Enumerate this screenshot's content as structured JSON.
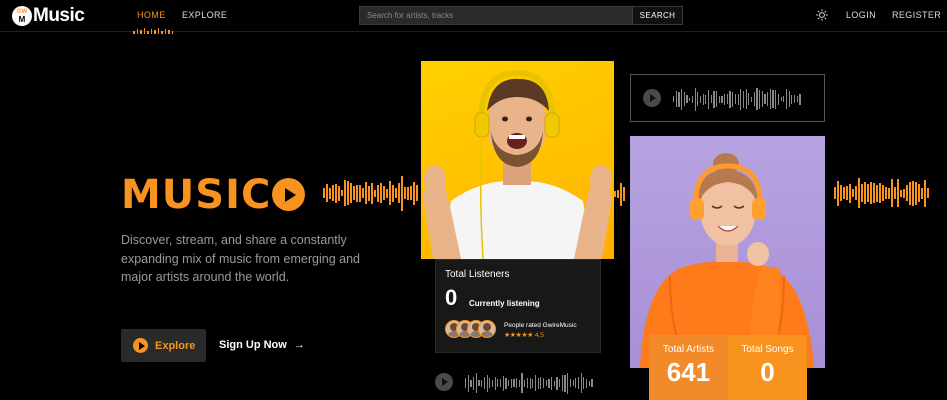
{
  "nav": {
    "logo_badge_top": "GW",
    "logo_badge_bottom": "M",
    "logo_text": "Music",
    "links": [
      {
        "label": "HOME",
        "active": true
      },
      {
        "label": "EXPLORE",
        "active": false
      }
    ],
    "search_placeholder": "Search for artists, tracks",
    "search_button": "SEARCH",
    "theme_icon": "sun-icon",
    "login": "LOGIN",
    "register": "REGISTER"
  },
  "hero": {
    "title": "MUSIC",
    "description": "Discover, stream, and share a constantly expanding mix of music from emerging and major artists around the world.",
    "explore_label": "Explore",
    "signup_label": "Sign Up Now",
    "signup_arrow": "→"
  },
  "listeners_card": {
    "title": "Total Listeners",
    "count": "0",
    "count_caption": "Currently listening",
    "rated_text": "People rated GwireMusic",
    "stars": "★★★★★",
    "rating": "4.5"
  },
  "stats": {
    "artists_label": "Total Artists",
    "artists_value": "641",
    "songs_label": "Total Songs",
    "songs_value": "0"
  },
  "colors": {
    "accent": "#f7931e",
    "background": "#000000",
    "muted_text": "#9a9a9a",
    "yellow_photo": "#ffc400",
    "purple_photo": "#b09ad9"
  }
}
